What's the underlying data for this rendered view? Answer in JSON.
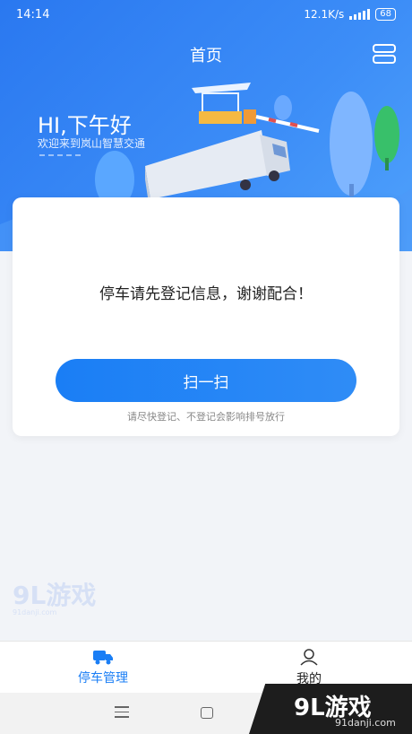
{
  "status_bar": {
    "time": "14:14",
    "network_speed": "12.1K/s",
    "battery": "68"
  },
  "header": {
    "title": "首页",
    "greeting": "HI,下午好",
    "subtitle": "欢迎来到岚山智慧交通"
  },
  "card": {
    "message": "停车请先登记信息，谢谢配合！",
    "scan_button": "扫一扫",
    "note": "请尽快登记、不登记会影响排号放行"
  },
  "tabs": [
    {
      "label": "停车管理",
      "icon": "truck-icon",
      "active": true
    },
    {
      "label": "我的",
      "icon": "user-icon",
      "active": false
    }
  ],
  "watermark": {
    "brand": "9L游戏",
    "site": "91danji.com"
  },
  "colors": {
    "primary": "#1a7ef5",
    "header_bg": "#2f83f5"
  }
}
